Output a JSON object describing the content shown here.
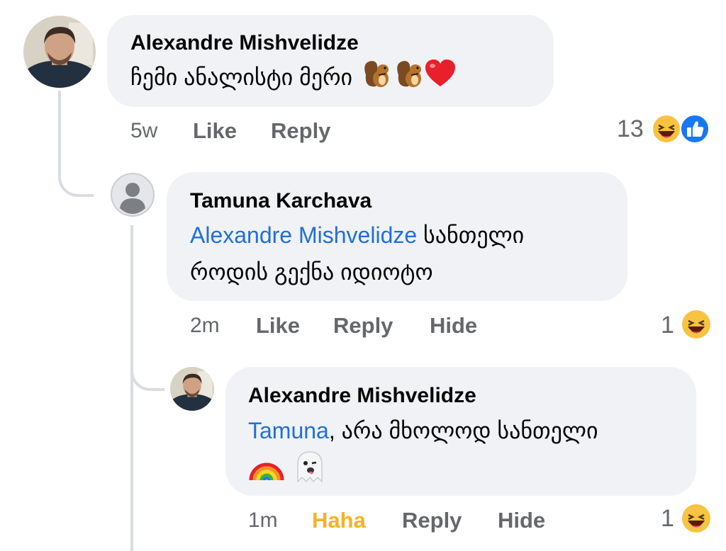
{
  "comments": [
    {
      "author": "Alexandre Mishvelidze",
      "text": "ჩემი ანალისტი მერი",
      "emoji": [
        "chipmunk",
        "chipmunk",
        "red-heart"
      ],
      "time": "5w",
      "actions": [
        "Like",
        "Reply"
      ],
      "reaction_count": "13",
      "reactions": [
        "haha",
        "like"
      ]
    },
    {
      "author": "Tamuna Karchava",
      "mention": "Alexandre Mishvelidze",
      "text_line1": "სანთელი",
      "text_line2": "როდის გექნა იდიოტო",
      "time": "2m",
      "actions": [
        "Like",
        "Reply",
        "Hide"
      ],
      "reaction_count": "1",
      "reactions": [
        "haha"
      ]
    },
    {
      "author": "Alexandre Mishvelidze",
      "mention": "Tamuna",
      "text_line1": ", არა მხოლოდ სანთელი",
      "emoji": [
        "rainbow",
        "ghost"
      ],
      "time": "1m",
      "actions": [
        "Haha",
        "Reply",
        "Hide"
      ],
      "reaction_count": "1",
      "reactions": [
        "haha"
      ]
    }
  ],
  "colors": {
    "bubble": "#f0f2f5",
    "mention": "#216fdb",
    "meta": "#65676b",
    "haha_active": "#f7b125",
    "like_blue": "#1877f2"
  }
}
